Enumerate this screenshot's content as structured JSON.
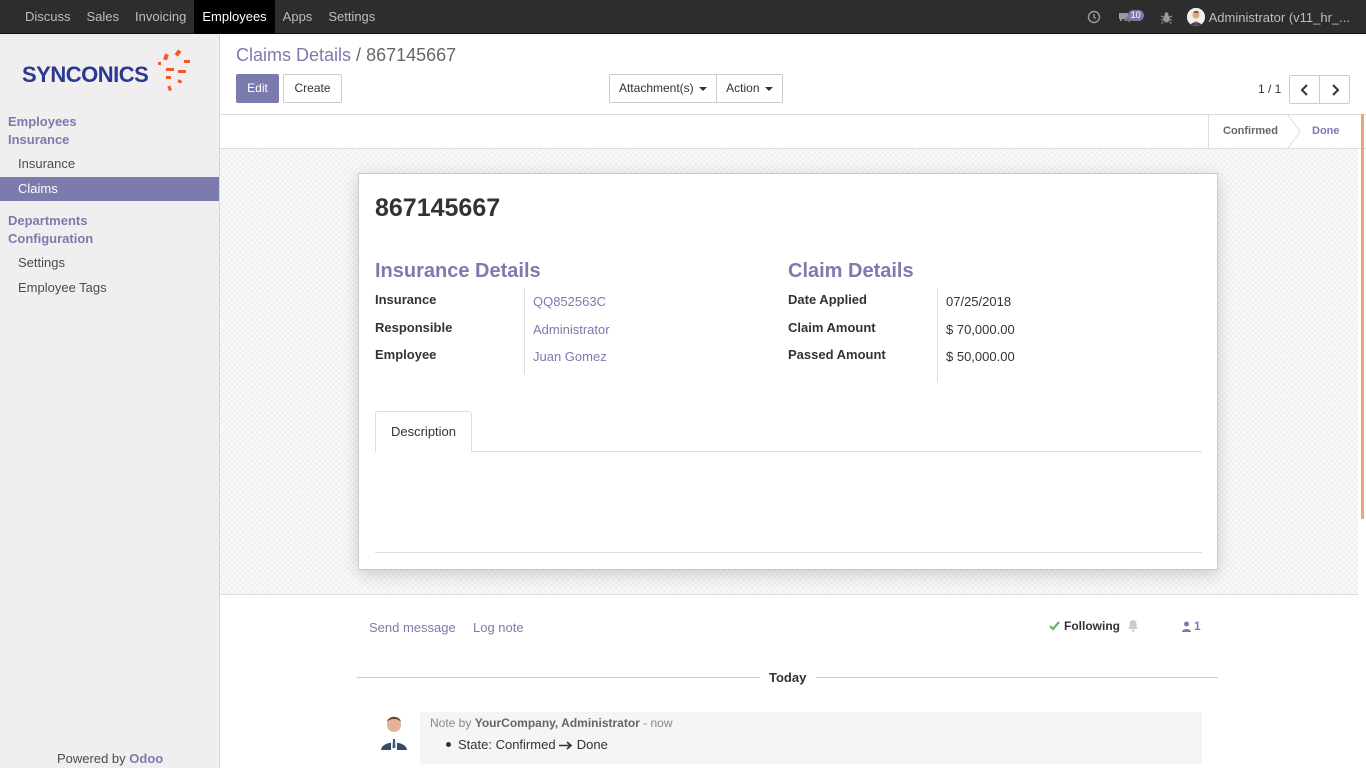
{
  "topnav": {
    "items": [
      {
        "label": "Discuss"
      },
      {
        "label": "Sales"
      },
      {
        "label": "Invoicing"
      },
      {
        "label": "Employees",
        "active": true
      },
      {
        "label": "Apps"
      },
      {
        "label": "Settings"
      }
    ],
    "icons": [
      "clock-icon",
      "chat-icon",
      "bug-icon"
    ],
    "message_count": "10",
    "user_name": "Administrator (v11_hr_..."
  },
  "sidebar": {
    "logo_text": "SYNCONICS",
    "sections": [
      {
        "label": "Employees",
        "key": "employees"
      },
      {
        "label": "Insurance",
        "key": "insurance"
      },
      {
        "label": "Departments",
        "key": "departments"
      },
      {
        "label": "Configuration",
        "key": "configuration"
      }
    ],
    "items": {
      "insurance": {
        "label": "Insurance"
      },
      "claims": {
        "label": "Claims",
        "active": true
      },
      "settings": {
        "label": "Settings"
      },
      "employee_tags": {
        "label": "Employee Tags"
      }
    },
    "powered_by": "Powered by",
    "powered_brand": "Odoo"
  },
  "control_panel": {
    "breadcrumb_parent": "Claims Details",
    "breadcrumb_sep": "/",
    "breadcrumb_current": "867145667",
    "edit_label": "Edit",
    "create_label": "Create",
    "attachments_label": "Attachment(s)",
    "action_label": "Action",
    "pager": "1 / 1"
  },
  "statusbar": {
    "stages": [
      {
        "label": "Confirmed",
        "current": true
      },
      {
        "label": "Done",
        "current": false
      }
    ]
  },
  "form": {
    "name": "867145667",
    "insurance_group": {
      "title": "Insurance Details",
      "fields": [
        {
          "label": "Insurance",
          "value": "QQ852563C"
        },
        {
          "label": "Responsible",
          "value": "Administrator"
        },
        {
          "label": "Employee",
          "value": "Juan Gomez"
        }
      ]
    },
    "claim_group": {
      "title": "Claim Details",
      "fields": [
        {
          "label": "Date Applied",
          "value": "07/25/2018"
        },
        {
          "label": "Claim Amount",
          "value": "$ 70,000.00"
        },
        {
          "label": "Passed Amount",
          "value": "$ 50,000.00"
        }
      ]
    },
    "tab_label": "Description"
  },
  "chatter": {
    "send_message": "Send message",
    "log_note": "Log note",
    "following": "Following",
    "followers_count": "1",
    "date_separator": "Today",
    "message": {
      "prefix": "Note by",
      "author": "YourCompany, Administrator",
      "time": "- now",
      "change_from": "State: Confirmed",
      "change_to": "Done"
    }
  },
  "colors": {
    "accent": "#7c7bad",
    "topbar": "#2d2d2d",
    "logo_blue": "#2b3990",
    "logo_orange": "#f05a28"
  }
}
